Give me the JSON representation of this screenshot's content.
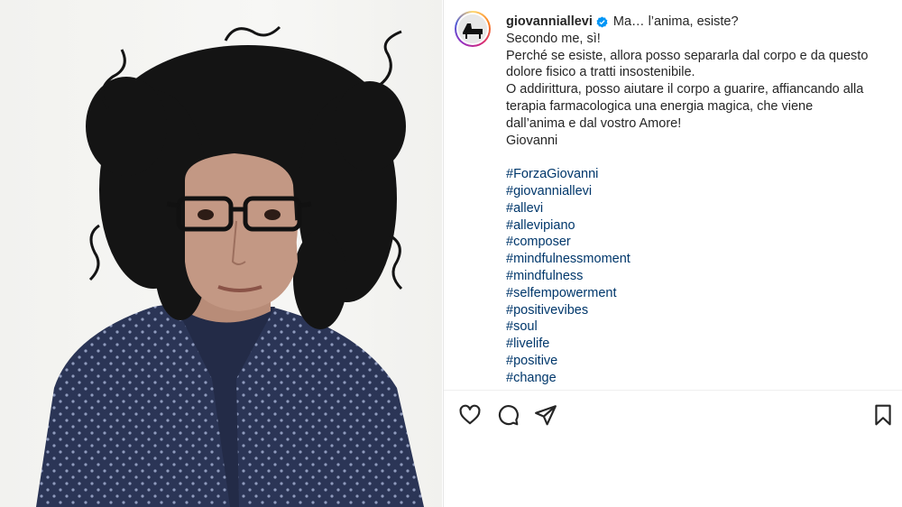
{
  "post": {
    "username": "giovanniallevi",
    "verified": true,
    "title": "Ma… l’anima, esiste?",
    "lines": [
      "Secondo me, sì!",
      "Perché se esiste, allora posso separarla dal corpo e da questo",
      "dolore fisico a tratti insostenibile.",
      "O addirittura, posso aiutare il corpo a guarire, affiancando alla",
      "terapia farmacologica una energia magica, che viene",
      "dall’anima e dal vostro Amore!",
      "Giovanni"
    ],
    "hashtags": [
      "#ForzaGiovanni",
      "#giovanniallevi",
      "#allevi",
      "#allevipiano",
      "#composer",
      "#mindfulnessmoment",
      "#mindfulness",
      "#selfempowerment",
      "#positivevibes",
      "#soul",
      "#livelife",
      "#positive",
      "#change"
    ]
  },
  "icons": {
    "like": "heart-icon",
    "comment": "comment-icon",
    "share": "share-icon",
    "save": "bookmark-icon",
    "verified": "verified-badge-icon"
  },
  "colors": {
    "text": "#262626",
    "hashtag": "#00376b",
    "verified": "#0095f6"
  }
}
